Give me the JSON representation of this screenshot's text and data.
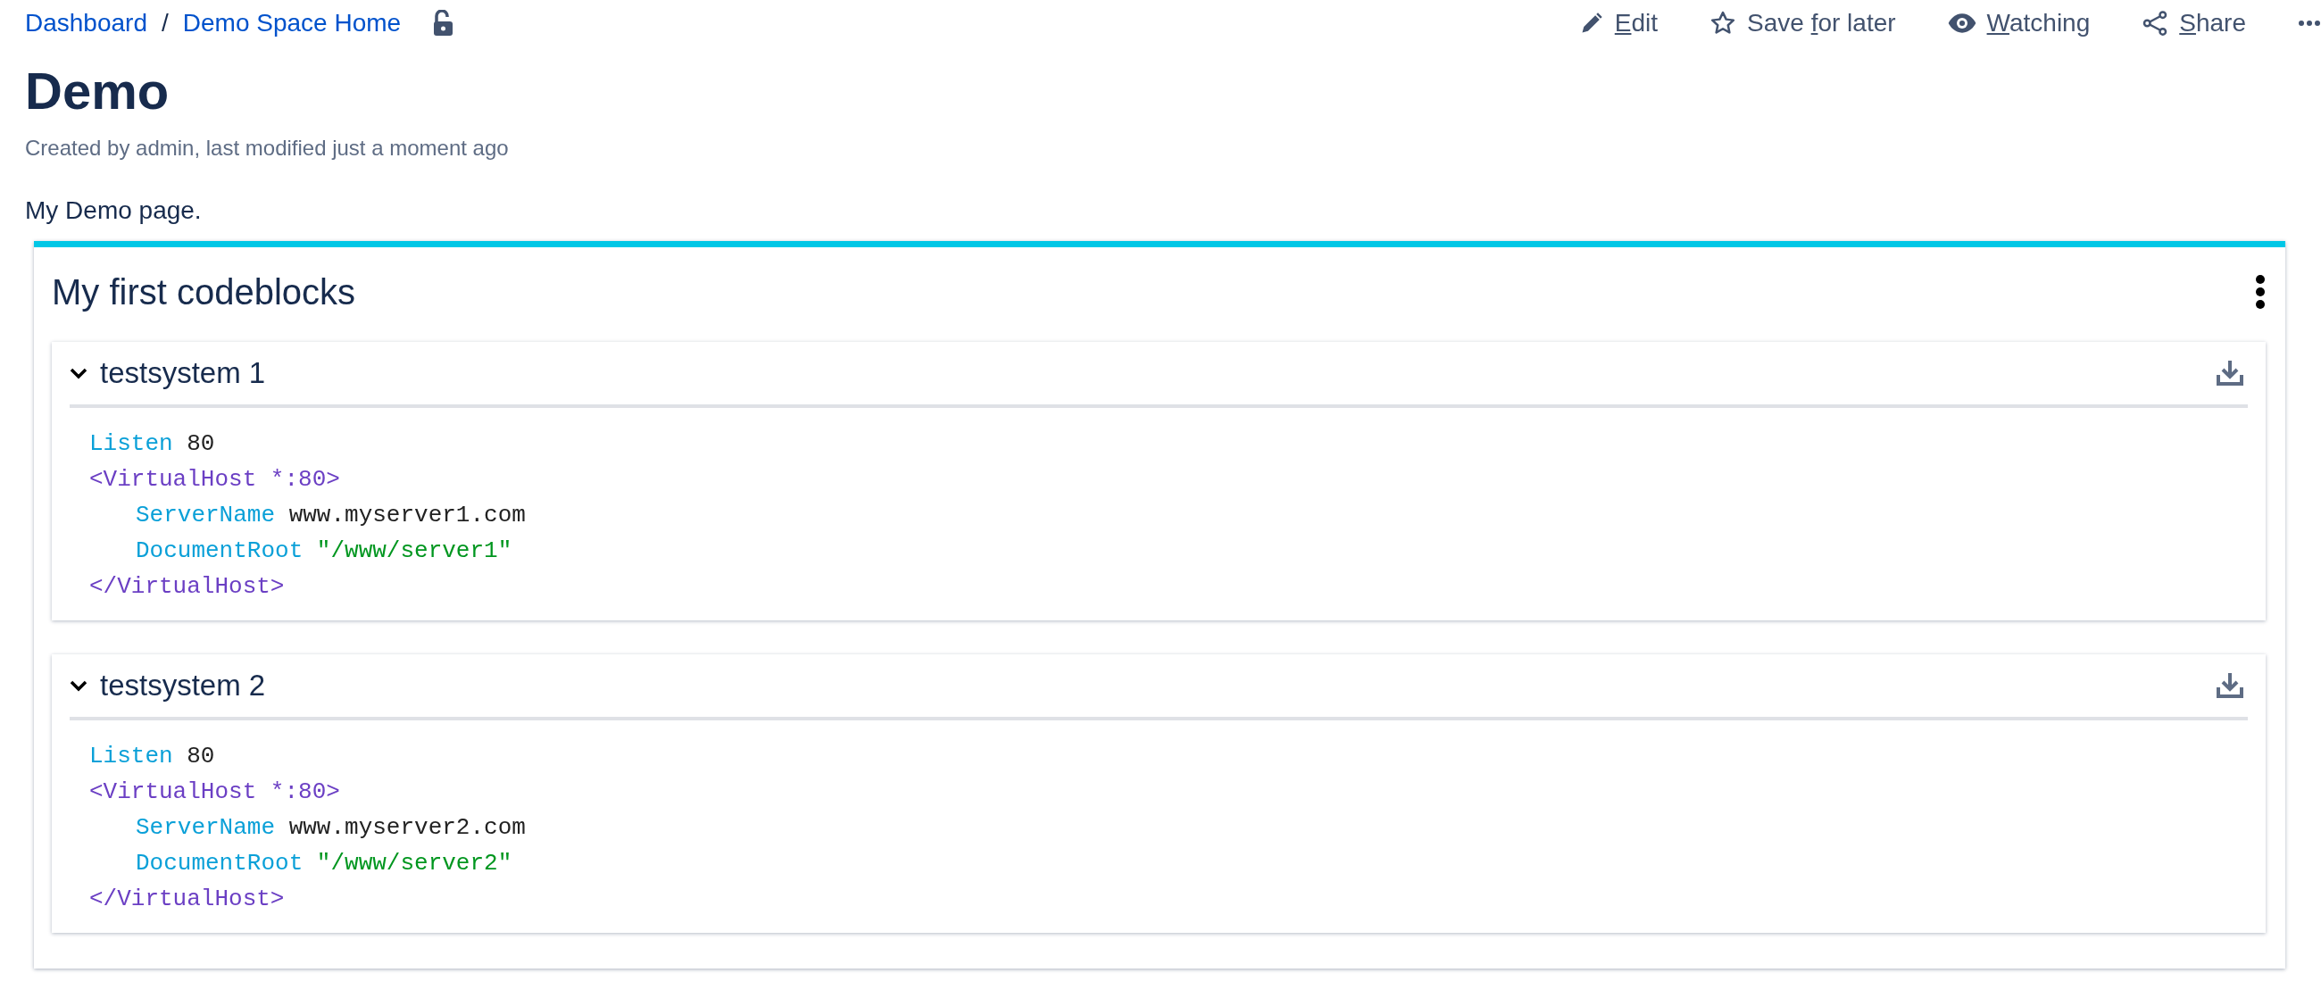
{
  "breadcrumbs": [
    {
      "label": "Dashboard"
    },
    {
      "separator": "/",
      "label": "Demo Space Home"
    }
  ],
  "actions": [
    {
      "kind": "edit",
      "label": [
        {
          "text": "E",
          "underlined": true
        },
        {
          "text": "dit",
          "underlined": false
        }
      ]
    },
    {
      "kind": "save",
      "label": [
        {
          "text": "Save ",
          "underlined": false
        },
        {
          "text": "f",
          "underlined": true
        },
        {
          "text": "or later",
          "underlined": false
        }
      ]
    },
    {
      "kind": "watch",
      "label": [
        {
          "text": "W",
          "underlined": true
        },
        {
          "text": "atching",
          "underlined": false
        }
      ]
    },
    {
      "kind": "share",
      "label": [
        {
          "text": "S",
          "underlined": true
        },
        {
          "text": "hare",
          "underlined": false
        }
      ]
    }
  ],
  "title": "Demo",
  "byline": "Created by admin, last modified just a moment ago",
  "body": "My Demo page.",
  "panel": {
    "title": "My first codeblocks",
    "codeblocks": [
      {
        "title": "testsystem 1",
        "expanded": true,
        "lines": [
          {
            "indent": false,
            "tokens": [
              {
                "kind": "keyword",
                "text": "Listen"
              },
              {
                "kind": "plain",
                "text": "80"
              }
            ]
          },
          {
            "indent": false,
            "tokens": [
              {
                "kind": "tag",
                "text": "<VirtualHost *:80>"
              }
            ]
          },
          {
            "indent": true,
            "tokens": [
              {
                "kind": "keyword",
                "text": "ServerName"
              },
              {
                "kind": "plain",
                "text": "www.myserver1.com"
              }
            ]
          },
          {
            "indent": true,
            "tokens": [
              {
                "kind": "keyword",
                "text": "DocumentRoot"
              },
              {
                "kind": "string",
                "text": "\"/www/server1\""
              }
            ]
          },
          {
            "indent": false,
            "tokens": [
              {
                "kind": "tag",
                "text": "</VirtualHost>"
              }
            ]
          }
        ]
      },
      {
        "title": "testsystem 2",
        "expanded": true,
        "lines": [
          {
            "indent": false,
            "tokens": [
              {
                "kind": "keyword",
                "text": "Listen"
              },
              {
                "kind": "plain",
                "text": "80"
              }
            ]
          },
          {
            "indent": false,
            "tokens": [
              {
                "kind": "tag",
                "text": "<VirtualHost *:80>"
              }
            ]
          },
          {
            "indent": true,
            "tokens": [
              {
                "kind": "keyword",
                "text": "ServerName"
              },
              {
                "kind": "plain",
                "text": "www.myserver2.com"
              }
            ]
          },
          {
            "indent": true,
            "tokens": [
              {
                "kind": "keyword",
                "text": "DocumentRoot"
              },
              {
                "kind": "string",
                "text": "\"/www/server2\""
              }
            ]
          },
          {
            "indent": false,
            "tokens": [
              {
                "kind": "tag",
                "text": "</VirtualHost>"
              }
            ]
          }
        ]
      }
    ]
  }
}
